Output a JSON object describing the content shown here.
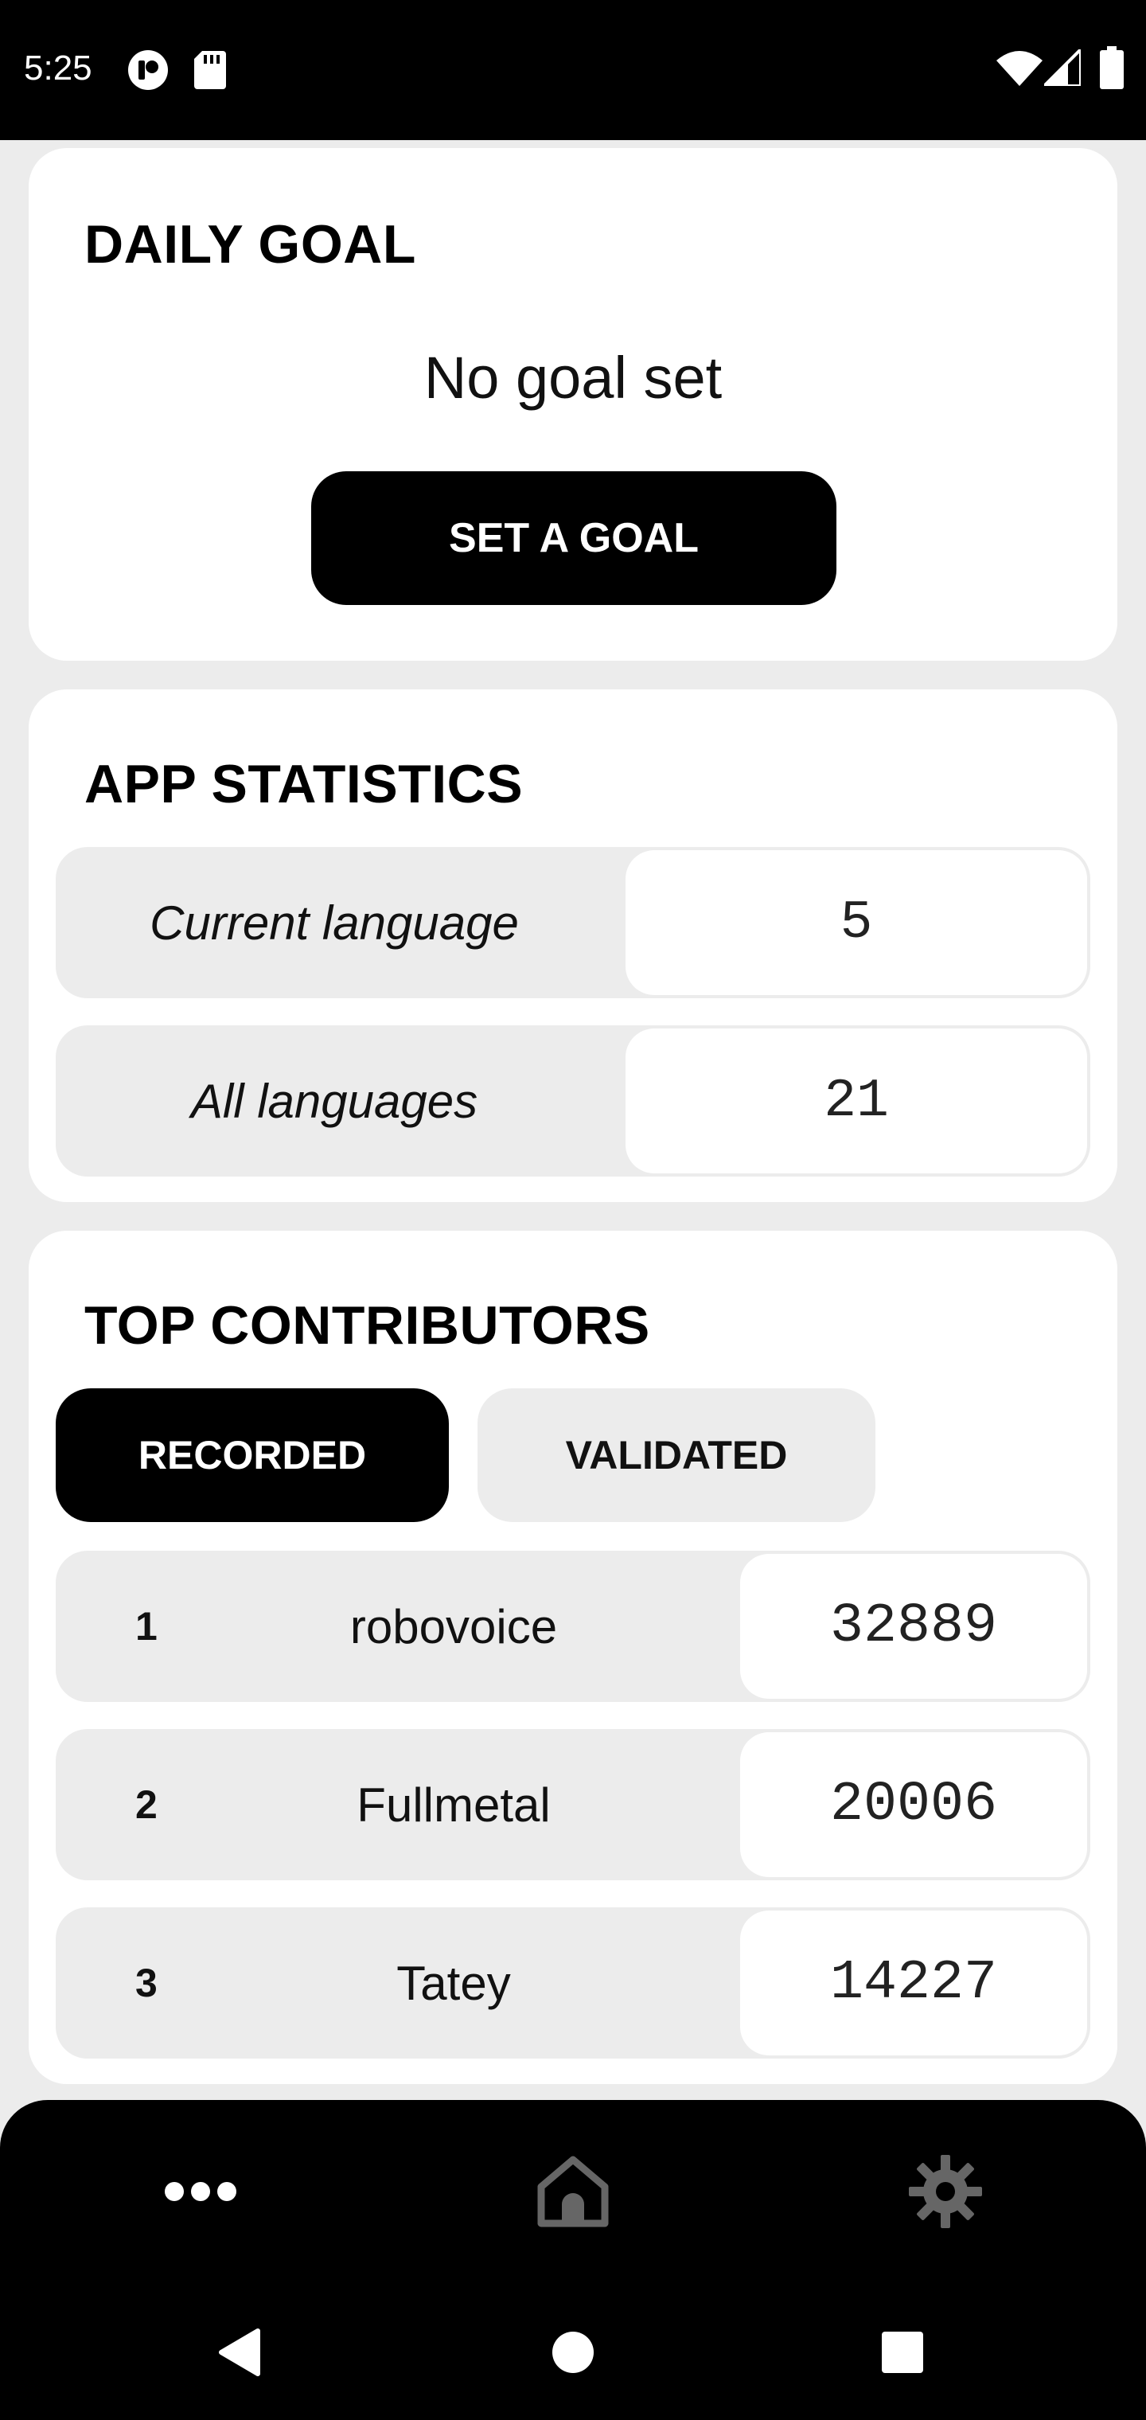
{
  "status_bar": {
    "time": "5:25",
    "left_icons": [
      "notification-app-icon",
      "sd-card-icon"
    ],
    "right_icons": [
      "wifi-icon",
      "cell-signal-icon",
      "battery-icon"
    ]
  },
  "daily_goal": {
    "title": "DAILY GOAL",
    "goal_text": "No goal set",
    "button_label": "SET A GOAL"
  },
  "app_statistics": {
    "title": "APP STATISTICS",
    "rows": [
      {
        "label": "Current language",
        "value": "5"
      },
      {
        "label": "All languages",
        "value": "21"
      }
    ]
  },
  "top_contributors": {
    "title": "TOP CONTRIBUTORS",
    "tabs": [
      {
        "label": "RECORDED",
        "active": true
      },
      {
        "label": "VALIDATED",
        "active": false
      }
    ],
    "rows": [
      {
        "rank": "1",
        "name": "robovoice",
        "count": "32889"
      },
      {
        "rank": "2",
        "name": "Fullmetal",
        "count": "20006"
      },
      {
        "rank": "3",
        "name": "Tatey",
        "count": "14227"
      }
    ]
  },
  "bottom_nav": {
    "items": [
      {
        "icon": "more-dots-icon",
        "active": true
      },
      {
        "icon": "home-icon",
        "active": false
      },
      {
        "icon": "settings-gear-icon",
        "active": false
      }
    ]
  },
  "system_nav": {
    "items": [
      "back-icon",
      "home-circle-icon",
      "recents-square-icon"
    ]
  },
  "colors": {
    "background": "#ececec",
    "card": "#ffffff",
    "accent": "#000000",
    "inactive_icon": "#666666"
  }
}
